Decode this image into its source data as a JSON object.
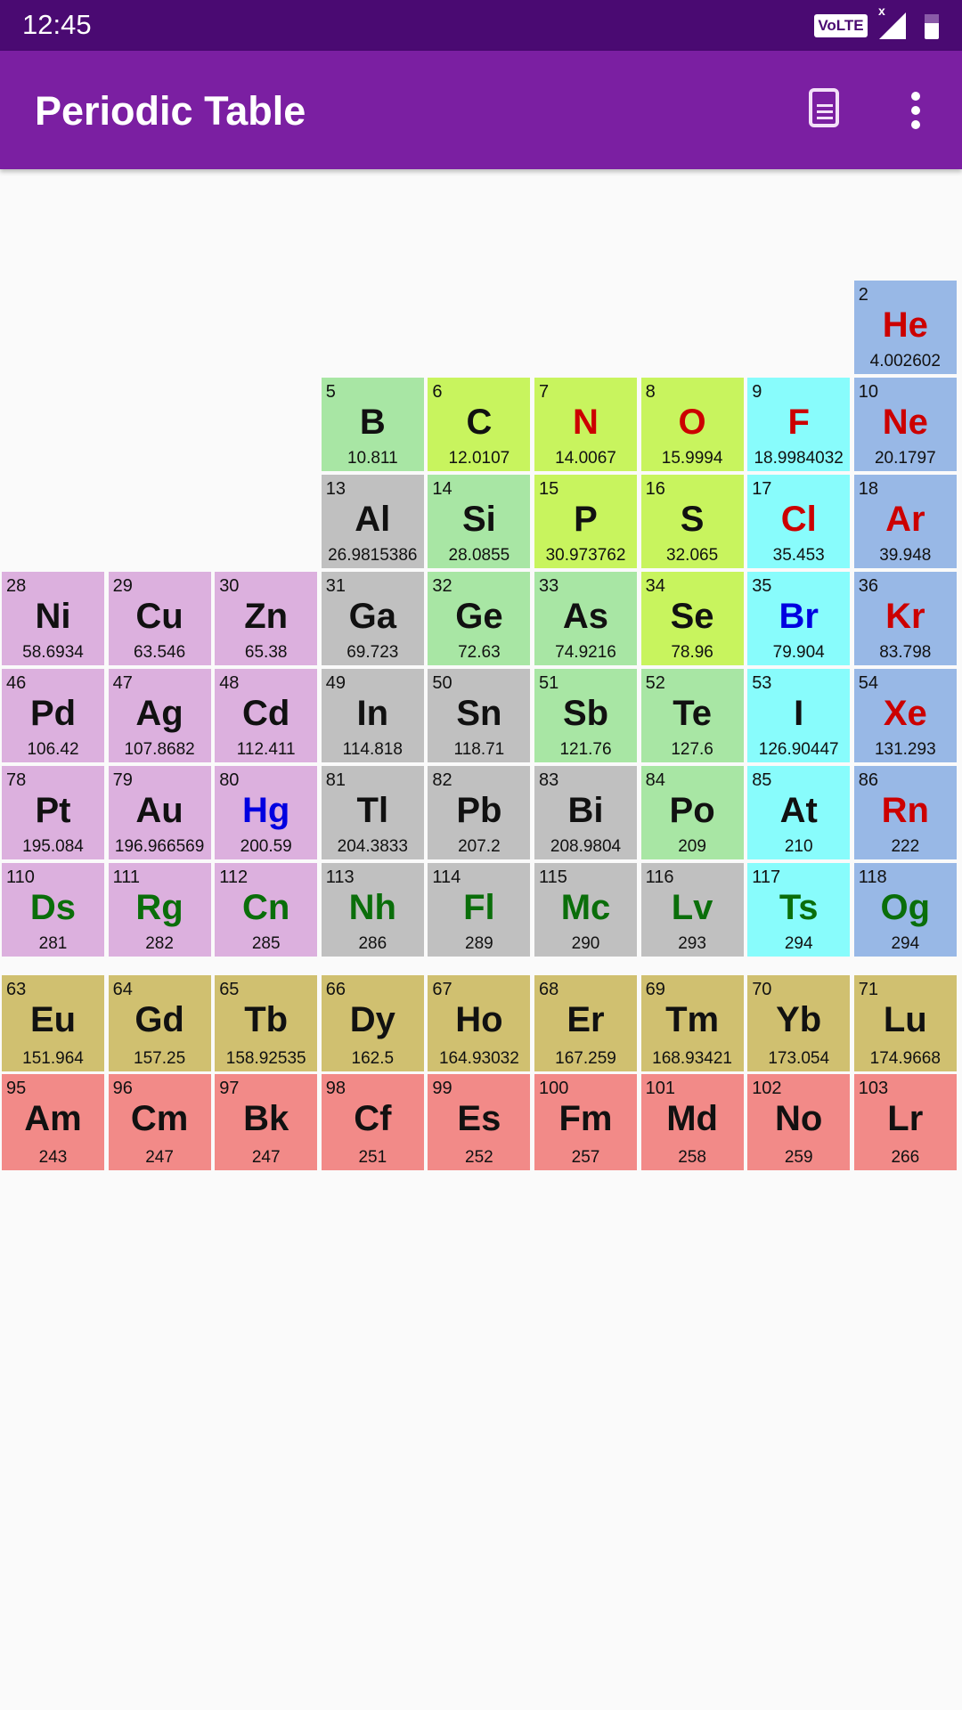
{
  "status_bar": {
    "time": "12:45",
    "volte": "VoLTE",
    "signal_x": "x"
  },
  "app_bar": {
    "title": "Periodic Table",
    "doc_icon": "document-icon",
    "menu_icon": "more-vert-icon"
  },
  "category_colors": {
    "transition": "#dcb0de",
    "post": "#c0c0c0",
    "metalloid": "#a8e6a4",
    "nonmetal": "#c8f45e",
    "halogen": "#88fcfc",
    "noble": "#98b8e6",
    "lanthanide": "#d0c070",
    "actinide": "#f28a88"
  },
  "state_colors": {
    "solid": "#111111",
    "gas": "#cc0000",
    "liquid": "#0000e0",
    "synthetic": "#0a6e0a"
  },
  "elements": [
    {
      "n": "2",
      "s": "He",
      "m": "4.002602",
      "c": "noble",
      "st": "gas",
      "col": 8,
      "row": 0
    },
    {
      "n": "5",
      "s": "B",
      "m": "10.811",
      "c": "metalloid",
      "st": "solid",
      "col": 3,
      "row": 1
    },
    {
      "n": "6",
      "s": "C",
      "m": "12.0107",
      "c": "nonmetal",
      "st": "solid",
      "col": 4,
      "row": 1
    },
    {
      "n": "7",
      "s": "N",
      "m": "14.0067",
      "c": "nonmetal",
      "st": "gas",
      "col": 5,
      "row": 1
    },
    {
      "n": "8",
      "s": "O",
      "m": "15.9994",
      "c": "nonmetal",
      "st": "gas",
      "col": 6,
      "row": 1
    },
    {
      "n": "9",
      "s": "F",
      "m": "18.9984032",
      "c": "halogen",
      "st": "gas",
      "col": 7,
      "row": 1
    },
    {
      "n": "10",
      "s": "Ne",
      "m": "20.1797",
      "c": "noble",
      "st": "gas",
      "col": 8,
      "row": 1
    },
    {
      "n": "13",
      "s": "Al",
      "m": "26.9815386",
      "c": "post",
      "st": "solid",
      "col": 3,
      "row": 2
    },
    {
      "n": "14",
      "s": "Si",
      "m": "28.0855",
      "c": "metalloid",
      "st": "solid",
      "col": 4,
      "row": 2
    },
    {
      "n": "15",
      "s": "P",
      "m": "30.973762",
      "c": "nonmetal",
      "st": "solid",
      "col": 5,
      "row": 2
    },
    {
      "n": "16",
      "s": "S",
      "m": "32.065",
      "c": "nonmetal",
      "st": "solid",
      "col": 6,
      "row": 2
    },
    {
      "n": "17",
      "s": "Cl",
      "m": "35.453",
      "c": "halogen",
      "st": "gas",
      "col": 7,
      "row": 2
    },
    {
      "n": "18",
      "s": "Ar",
      "m": "39.948",
      "c": "noble",
      "st": "gas",
      "col": 8,
      "row": 2
    },
    {
      "n": "28",
      "s": "Ni",
      "m": "58.6934",
      "c": "transition",
      "st": "solid",
      "col": 0,
      "row": 3
    },
    {
      "n": "29",
      "s": "Cu",
      "m": "63.546",
      "c": "transition",
      "st": "solid",
      "col": 1,
      "row": 3
    },
    {
      "n": "30",
      "s": "Zn",
      "m": "65.38",
      "c": "transition",
      "st": "solid",
      "col": 2,
      "row": 3
    },
    {
      "n": "31",
      "s": "Ga",
      "m": "69.723",
      "c": "post",
      "st": "solid",
      "col": 3,
      "row": 3
    },
    {
      "n": "32",
      "s": "Ge",
      "m": "72.63",
      "c": "metalloid",
      "st": "solid",
      "col": 4,
      "row": 3
    },
    {
      "n": "33",
      "s": "As",
      "m": "74.9216",
      "c": "metalloid",
      "st": "solid",
      "col": 5,
      "row": 3
    },
    {
      "n": "34",
      "s": "Se",
      "m": "78.96",
      "c": "nonmetal",
      "st": "solid",
      "col": 6,
      "row": 3
    },
    {
      "n": "35",
      "s": "Br",
      "m": "79.904",
      "c": "halogen",
      "st": "liquid",
      "col": 7,
      "row": 3
    },
    {
      "n": "36",
      "s": "Kr",
      "m": "83.798",
      "c": "noble",
      "st": "gas",
      "col": 8,
      "row": 3
    },
    {
      "n": "46",
      "s": "Pd",
      "m": "106.42",
      "c": "transition",
      "st": "solid",
      "col": 0,
      "row": 4
    },
    {
      "n": "47",
      "s": "Ag",
      "m": "107.8682",
      "c": "transition",
      "st": "solid",
      "col": 1,
      "row": 4
    },
    {
      "n": "48",
      "s": "Cd",
      "m": "112.411",
      "c": "transition",
      "st": "solid",
      "col": 2,
      "row": 4
    },
    {
      "n": "49",
      "s": "In",
      "m": "114.818",
      "c": "post",
      "st": "solid",
      "col": 3,
      "row": 4
    },
    {
      "n": "50",
      "s": "Sn",
      "m": "118.71",
      "c": "post",
      "st": "solid",
      "col": 4,
      "row": 4
    },
    {
      "n": "51",
      "s": "Sb",
      "m": "121.76",
      "c": "metalloid",
      "st": "solid",
      "col": 5,
      "row": 4
    },
    {
      "n": "52",
      "s": "Te",
      "m": "127.6",
      "c": "metalloid",
      "st": "solid",
      "col": 6,
      "row": 4
    },
    {
      "n": "53",
      "s": "I",
      "m": "126.90447",
      "c": "halogen",
      "st": "solid",
      "col": 7,
      "row": 4
    },
    {
      "n": "54",
      "s": "Xe",
      "m": "131.293",
      "c": "noble",
      "st": "gas",
      "col": 8,
      "row": 4
    },
    {
      "n": "78",
      "s": "Pt",
      "m": "195.084",
      "c": "transition",
      "st": "solid",
      "col": 0,
      "row": 5
    },
    {
      "n": "79",
      "s": "Au",
      "m": "196.966569",
      "c": "transition",
      "st": "solid",
      "col": 1,
      "row": 5
    },
    {
      "n": "80",
      "s": "Hg",
      "m": "200.59",
      "c": "transition",
      "st": "liquid",
      "col": 2,
      "row": 5
    },
    {
      "n": "81",
      "s": "Tl",
      "m": "204.3833",
      "c": "post",
      "st": "solid",
      "col": 3,
      "row": 5
    },
    {
      "n": "82",
      "s": "Pb",
      "m": "207.2",
      "c": "post",
      "st": "solid",
      "col": 4,
      "row": 5
    },
    {
      "n": "83",
      "s": "Bi",
      "m": "208.9804",
      "c": "post",
      "st": "solid",
      "col": 5,
      "row": 5
    },
    {
      "n": "84",
      "s": "Po",
      "m": "209",
      "c": "metalloid",
      "st": "solid",
      "col": 6,
      "row": 5
    },
    {
      "n": "85",
      "s": "At",
      "m": "210",
      "c": "halogen",
      "st": "solid",
      "col": 7,
      "row": 5
    },
    {
      "n": "86",
      "s": "Rn",
      "m": "222",
      "c": "noble",
      "st": "gas",
      "col": 8,
      "row": 5
    },
    {
      "n": "110",
      "s": "Ds",
      "m": "281",
      "c": "transition",
      "st": "synthetic",
      "col": 0,
      "row": 6
    },
    {
      "n": "111",
      "s": "Rg",
      "m": "282",
      "c": "transition",
      "st": "synthetic",
      "col": 1,
      "row": 6
    },
    {
      "n": "112",
      "s": "Cn",
      "m": "285",
      "c": "transition",
      "st": "synthetic",
      "col": 2,
      "row": 6
    },
    {
      "n": "113",
      "s": "Nh",
      "m": "286",
      "c": "post",
      "st": "synthetic",
      "col": 3,
      "row": 6
    },
    {
      "n": "114",
      "s": "Fl",
      "m": "289",
      "c": "post",
      "st": "synthetic",
      "col": 4,
      "row": 6
    },
    {
      "n": "115",
      "s": "Mc",
      "m": "290",
      "c": "post",
      "st": "synthetic",
      "col": 5,
      "row": 6
    },
    {
      "n": "116",
      "s": "Lv",
      "m": "293",
      "c": "post",
      "st": "synthetic",
      "col": 6,
      "row": 6
    },
    {
      "n": "117",
      "s": "Ts",
      "m": "294",
      "c": "halogen",
      "st": "synthetic",
      "col": 7,
      "row": 6
    },
    {
      "n": "118",
      "s": "Og",
      "m": "294",
      "c": "noble",
      "st": "synthetic",
      "col": 8,
      "row": 6
    },
    {
      "n": "63",
      "s": "Eu",
      "m": "151.964",
      "c": "lanthanide",
      "st": "solid",
      "col": 0,
      "row": 7
    },
    {
      "n": "64",
      "s": "Gd",
      "m": "157.25",
      "c": "lanthanide",
      "st": "solid",
      "col": 1,
      "row": 7
    },
    {
      "n": "65",
      "s": "Tb",
      "m": "158.92535",
      "c": "lanthanide",
      "st": "solid",
      "col": 2,
      "row": 7
    },
    {
      "n": "66",
      "s": "Dy",
      "m": "162.5",
      "c": "lanthanide",
      "st": "solid",
      "col": 3,
      "row": 7
    },
    {
      "n": "67",
      "s": "Ho",
      "m": "164.93032",
      "c": "lanthanide",
      "st": "solid",
      "col": 4,
      "row": 7
    },
    {
      "n": "68",
      "s": "Er",
      "m": "167.259",
      "c": "lanthanide",
      "st": "solid",
      "col": 5,
      "row": 7
    },
    {
      "n": "69",
      "s": "Tm",
      "m": "168.93421",
      "c": "lanthanide",
      "st": "solid",
      "col": 6,
      "row": 7
    },
    {
      "n": "70",
      "s": "Yb",
      "m": "173.054",
      "c": "lanthanide",
      "st": "solid",
      "col": 7,
      "row": 7
    },
    {
      "n": "71",
      "s": "Lu",
      "m": "174.9668",
      "c": "lanthanide",
      "st": "solid",
      "col": 8,
      "row": 7
    },
    {
      "n": "95",
      "s": "Am",
      "m": "243",
      "c": "actinide",
      "st": "solid",
      "col": 0,
      "row": 8
    },
    {
      "n": "96",
      "s": "Cm",
      "m": "247",
      "c": "actinide",
      "st": "solid",
      "col": 1,
      "row": 8
    },
    {
      "n": "97",
      "s": "Bk",
      "m": "247",
      "c": "actinide",
      "st": "solid",
      "col": 2,
      "row": 8
    },
    {
      "n": "98",
      "s": "Cf",
      "m": "251",
      "c": "actinide",
      "st": "solid",
      "col": 3,
      "row": 8
    },
    {
      "n": "99",
      "s": "Es",
      "m": "252",
      "c": "actinide",
      "st": "solid",
      "col": 4,
      "row": 8
    },
    {
      "n": "100",
      "s": "Fm",
      "m": "257",
      "c": "actinide",
      "st": "solid",
      "col": 5,
      "row": 8
    },
    {
      "n": "101",
      "s": "Md",
      "m": "258",
      "c": "actinide",
      "st": "solid",
      "col": 6,
      "row": 8
    },
    {
      "n": "102",
      "s": "No",
      "m": "259",
      "c": "actinide",
      "st": "solid",
      "col": 7,
      "row": 8
    },
    {
      "n": "103",
      "s": "Lr",
      "m": "266",
      "c": "actinide",
      "st": "solid",
      "col": 8,
      "row": 8
    }
  ]
}
